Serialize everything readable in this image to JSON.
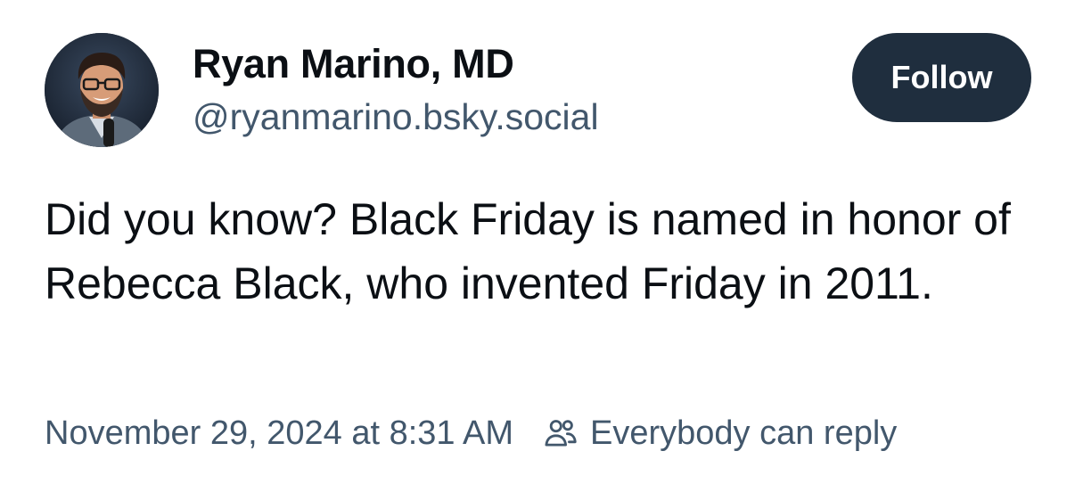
{
  "post": {
    "author": {
      "display_name": "Ryan Marino, MD",
      "handle": "@ryanmarino.bsky.social"
    },
    "follow_label": "Follow",
    "text": "Did you know? Black Friday is named in honor of Rebecca Black, who invented Friday in 2011.",
    "timestamp": "November 29, 2024 at 8:31 AM",
    "reply_setting": {
      "icon": "people-icon",
      "label": "Everybody can reply"
    }
  },
  "colors": {
    "follow_button_bg": "#1f2e3e",
    "secondary_text": "#42576c",
    "primary_text": "#0b0f14"
  }
}
